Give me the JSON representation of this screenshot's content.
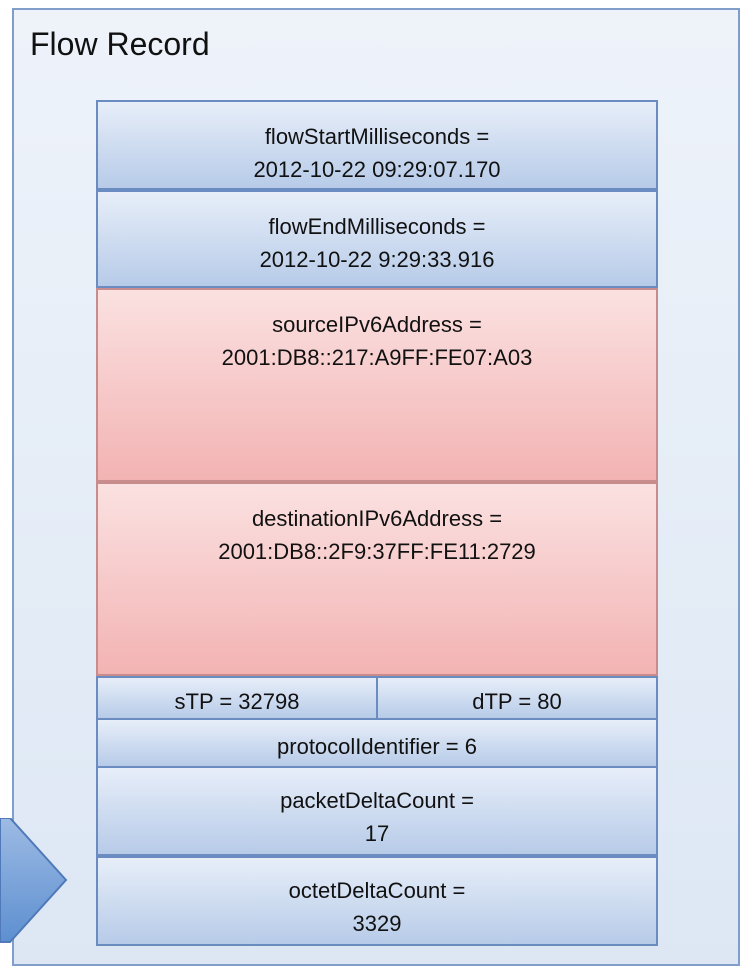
{
  "title": "Flow Record",
  "fields": {
    "flow_start": {
      "name": "flowStartMilliseconds =",
      "value": "2012-10-22 09:29:07.170"
    },
    "flow_end": {
      "name": "flowEndMilliseconds =",
      "value": "2012-10-22 9:29:33.916"
    },
    "source_ip": {
      "name": "sourceIPv6Address =",
      "value": "2001:DB8::217:A9FF:FE07:A03"
    },
    "destination_ip": {
      "name": "destinationIPv6Address =",
      "value": "2001:DB8::2F9:37FF:FE11:2729"
    },
    "stp": {
      "label": "sTP = 32798"
    },
    "dtp": {
      "label": "dTP = 80"
    },
    "protocol": {
      "label": "protocolIdentifier = 6"
    },
    "packet_delta": {
      "name": "packetDeltaCount =",
      "value": "17"
    },
    "octet_delta": {
      "name": "octetDeltaCount =",
      "value": "3329"
    }
  },
  "colors": {
    "ip_field_fill": "#f3b3b3",
    "field_fill": "#b7cbe8",
    "border": "#6a8cc0"
  }
}
